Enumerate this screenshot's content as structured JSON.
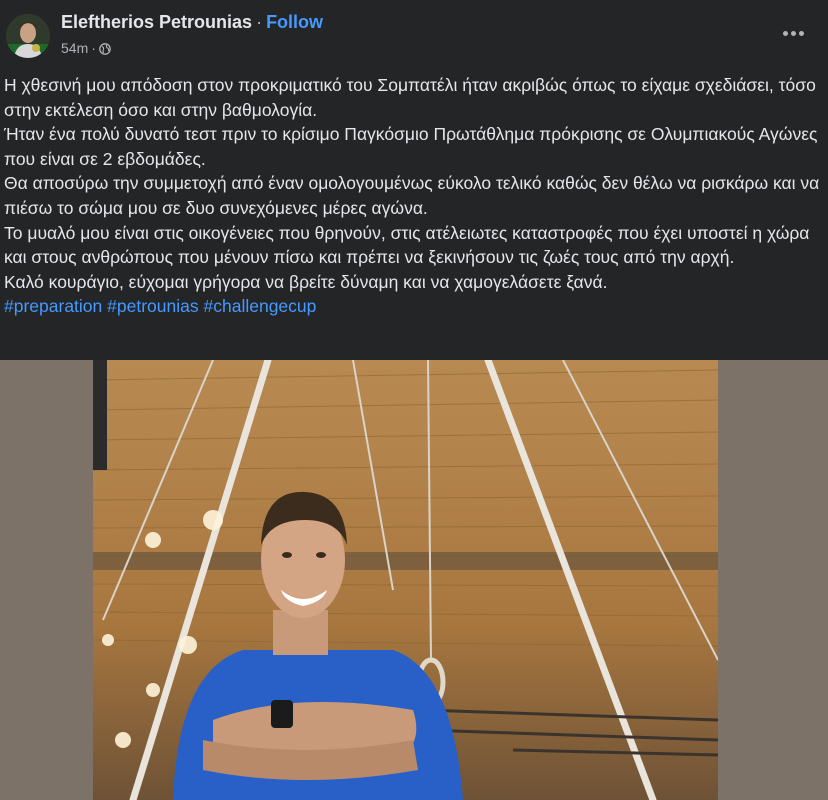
{
  "post": {
    "author": "Eleftherios Petrounias",
    "separator": "·",
    "follow_label": "Follow",
    "time": "54m",
    "meta_separator": "·",
    "privacy_icon": "globe-icon",
    "more_icon": "more-horizontal-icon",
    "text_lines": [
      "Η χθεσινή μου απόδοση στον προκριματικό του Σομπατέλι ήταν ακριβώς όπως το είχαμε σχεδιάσει, τόσο στην εκτέλεση όσο και στην βαθμολογία.",
      "Ήταν ένα πολύ δυνατό τεστ πριν το κρίσιμο Παγκόσμιο Πρωτάθλημα πρόκρισης σε Ολυμπιακούς Αγώνες που είναι σε 2 εβδομάδες.",
      "Θα αποσύρω την συμμετοχή από έναν ομολογουμένως εύκολο τελικό καθώς δεν θέλω να ρισκάρω και να πιέσω το σώμα μου σε δυο συνεχόμενες μέρες αγώνα.",
      "Το μυαλό μου είναι στις οικογένειες που θρηνούν, στις ατέλειωτες καταστροφές που έχει υποστεί η χώρα και στους ανθρώπους που μένουν πίσω και πρέπει να ξεκινήσουν τις ζωές τους από την αρχή.",
      "Καλό κουράγιο, εύχομαι γρήγορα να βρείτε δύναμη και να χαμογελάσετε ξανά."
    ],
    "hashtags": [
      "#preparation",
      "#petrounias",
      "#challengecup"
    ]
  },
  "colors": {
    "background": "#242526",
    "text": "#e4e6eb",
    "secondary_text": "#b0b3b8",
    "link": "#4599ff",
    "photo_side": "#7d7268"
  }
}
